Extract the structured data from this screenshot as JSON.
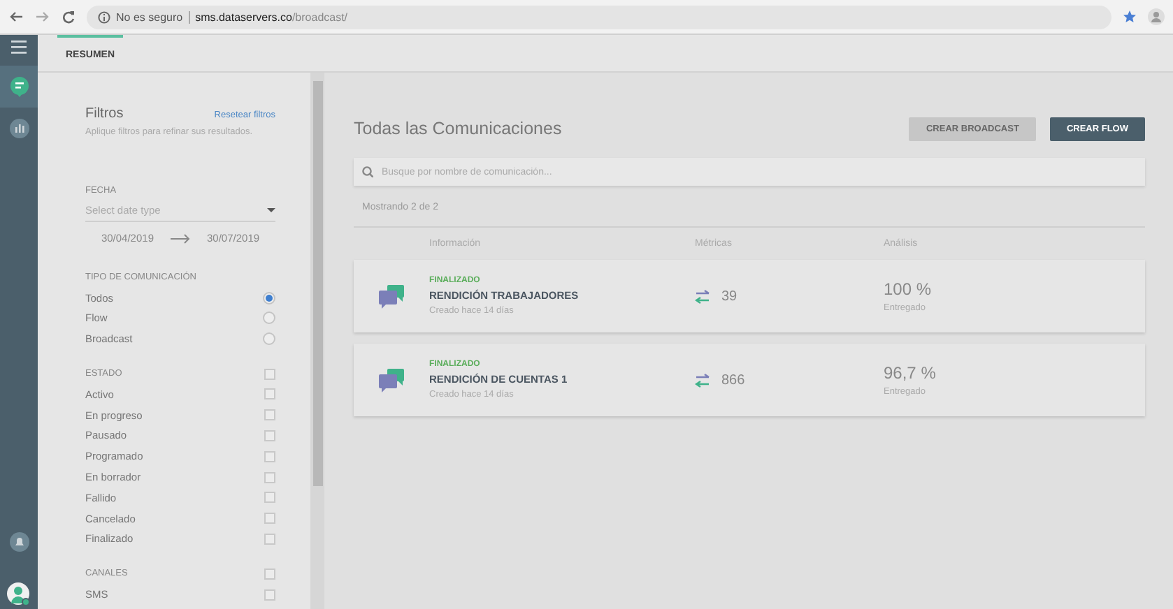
{
  "browser": {
    "security": "No es seguro",
    "url_host": "sms.dataservers.co",
    "url_path": "/broadcast/"
  },
  "rail": {
    "items": [
      {
        "selected": true
      },
      {
        "selected": false
      }
    ]
  },
  "tabs": [
    {
      "label": "RESUMEN",
      "selected": true
    }
  ],
  "filters": {
    "title": "Filtros",
    "reset_link": "Resetear filtros",
    "subtitle": "Aplique filtros para refinar sus resultados.",
    "date": {
      "label": "FECHA",
      "placeholder": "Select date type",
      "from": "30/04/2019",
      "to": "30/07/2019"
    },
    "type_group": {
      "label": "TIPO DE COMUNICACIÓN",
      "options": [
        {
          "label": "Todos",
          "selected": true
        },
        {
          "label": "Flow",
          "selected": false
        },
        {
          "label": "Broadcast",
          "selected": false
        }
      ]
    },
    "check_groups": [
      {
        "label": "ESTADO",
        "checked": false,
        "options": [
          {
            "label": "Activo",
            "checked": false
          },
          {
            "label": "En progreso",
            "checked": false
          },
          {
            "label": "Pausado",
            "checked": false
          },
          {
            "label": "Programado",
            "checked": false
          },
          {
            "label": "En borrador",
            "checked": false
          },
          {
            "label": "Fallido",
            "checked": false
          },
          {
            "label": "Cancelado",
            "checked": false
          },
          {
            "label": "Finalizado",
            "checked": false
          }
        ]
      },
      {
        "label": "CANALES",
        "checked": false,
        "options": [
          {
            "label": "SMS",
            "checked": false
          }
        ]
      }
    ]
  },
  "main": {
    "title": "Todas las Comunicaciones",
    "buttons": [
      {
        "label": "CREAR BROADCAST",
        "kind": "secondary"
      },
      {
        "label": "CREAR FLOW",
        "kind": "primary"
      }
    ],
    "search": {
      "placeholder": "Busque por nombre de comunicación..."
    },
    "count": "Mostrando 2 de 2",
    "columns": [
      "Información",
      "Métricas",
      "Análisis"
    ],
    "rows": [
      {
        "status": "FINALIZADO",
        "name": "RENDICIÓN TRABAJADORES",
        "created": "Creado hace 14 días",
        "metric": "39",
        "percent": "100 %",
        "percent_label": "Entregado"
      },
      {
        "status": "FINALIZADO",
        "name": "RENDICIÓN DE CUENTAS 1",
        "created": "Creado hace 14 días",
        "metric": "866",
        "percent": "96,7 %",
        "percent_label": "Entregado"
      }
    ]
  }
}
